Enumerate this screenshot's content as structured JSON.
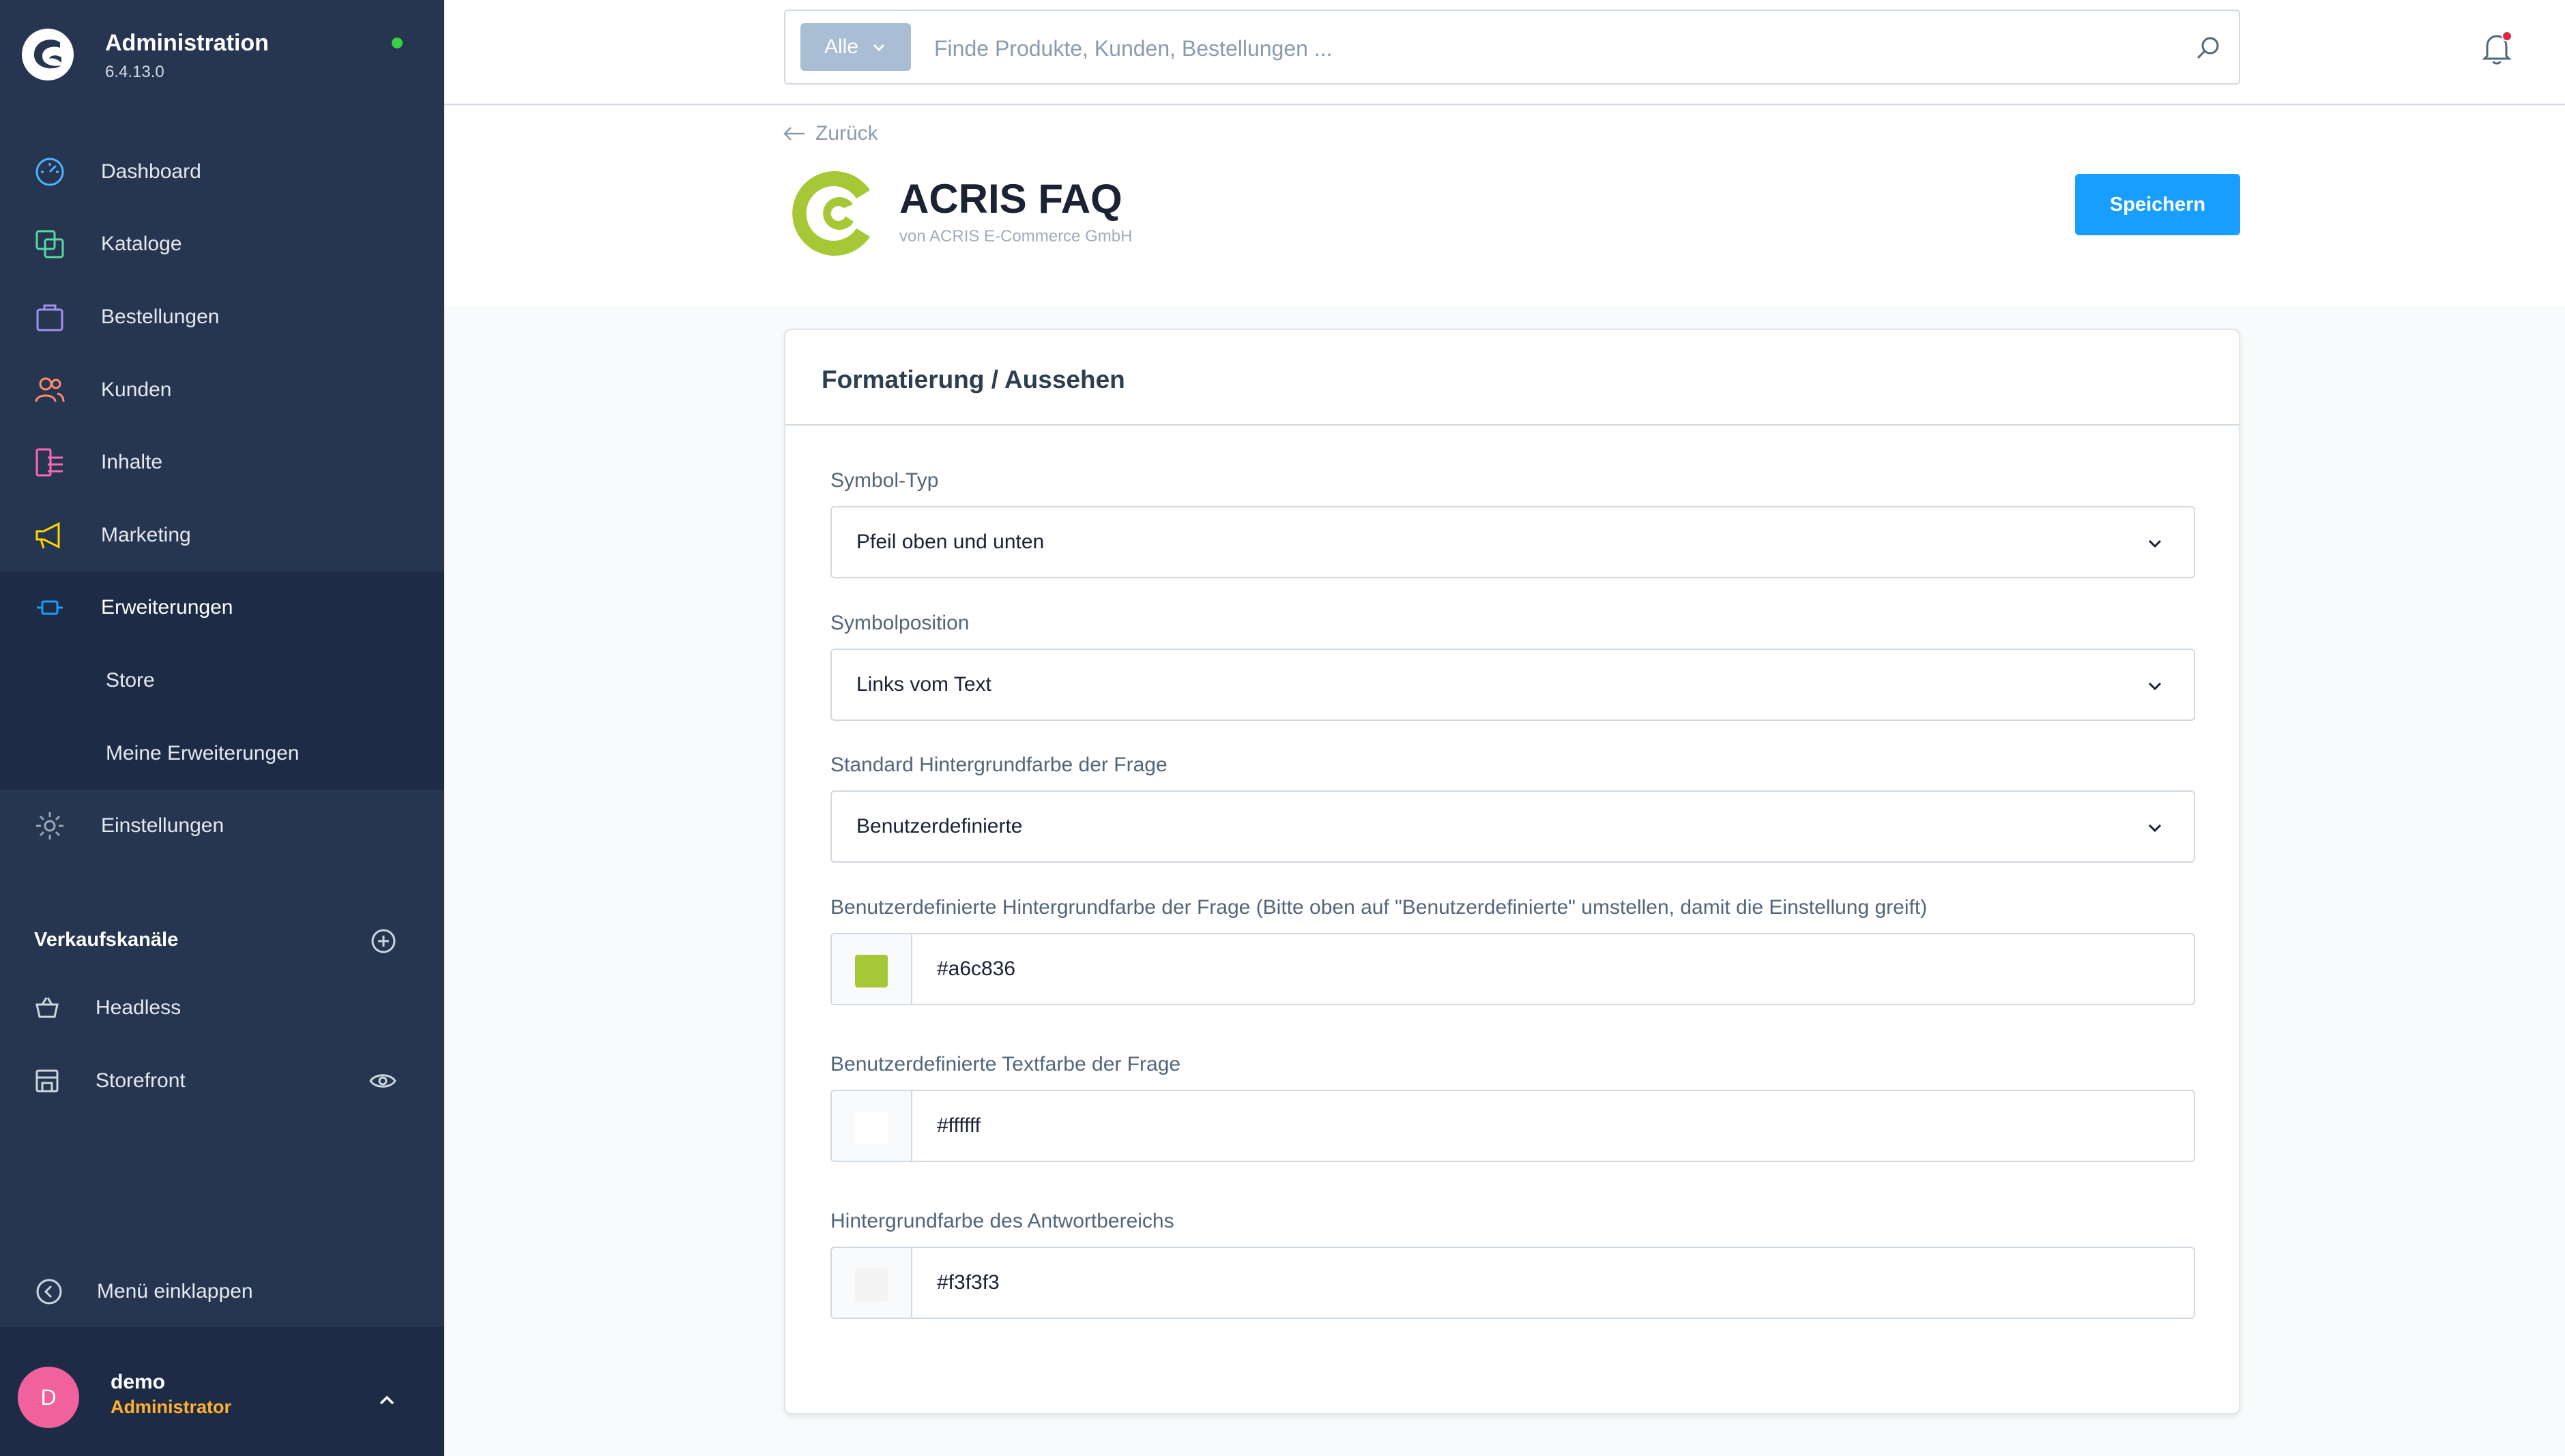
{
  "sidebar": {
    "title": "Administration",
    "version": "6.4.13.0",
    "status_color": "#37d046",
    "nav": [
      {
        "label": "Dashboard",
        "icon": "dashboard-icon"
      },
      {
        "label": "Kataloge",
        "icon": "catalog-icon"
      },
      {
        "label": "Bestellungen",
        "icon": "orders-icon"
      },
      {
        "label": "Kunden",
        "icon": "customers-icon"
      },
      {
        "label": "Inhalte",
        "icon": "content-icon"
      },
      {
        "label": "Marketing",
        "icon": "marketing-icon"
      },
      {
        "label": "Erweiterungen",
        "icon": "extensions-icon"
      },
      {
        "label": "Einstellungen",
        "icon": "settings-icon"
      }
    ],
    "sub_nav": [
      {
        "label": "Store"
      },
      {
        "label": "Meine Erweiterungen"
      }
    ],
    "channels_title": "Verkaufskanäle",
    "channels": [
      {
        "label": "Headless",
        "icon": "basket-icon"
      },
      {
        "label": "Storefront",
        "icon": "storefront-icon"
      }
    ],
    "collapse_label": "Menü einklappen",
    "user": {
      "initial": "D",
      "name": "demo",
      "role": "Administrator"
    }
  },
  "topbar": {
    "search_type": "Alle",
    "search_placeholder": "Finde Produkte, Kunden, Bestellungen ..."
  },
  "header": {
    "back_label": "Zurück",
    "plugin_name": "ACRIS FAQ",
    "vendor": "von ACRIS E-Commerce GmbH",
    "save_label": "Speichern"
  },
  "card": {
    "title": "Formatierung / Aussehen",
    "fields": [
      {
        "label": "Symbol-Typ",
        "value": "Pfeil oben und unten"
      },
      {
        "label": "Symbolposition",
        "value": "Links vom Text"
      },
      {
        "label": "Standard Hintergrundfarbe der Frage",
        "value": "Benutzerdefinierte"
      }
    ],
    "colors": [
      {
        "label": "Benutzerdefinierte Hintergrundfarbe der Frage (Bitte oben auf \"Benutzerdefinierte\" umstellen, damit die Einstellung greift)",
        "value": "#a6c836"
      },
      {
        "label": "Benutzerdefinierte Textfarbe der Frage",
        "value": "#ffffff"
      },
      {
        "label": "Hintergrundfarbe des Antwortbereichs",
        "value": "#f3f3f3"
      }
    ]
  }
}
